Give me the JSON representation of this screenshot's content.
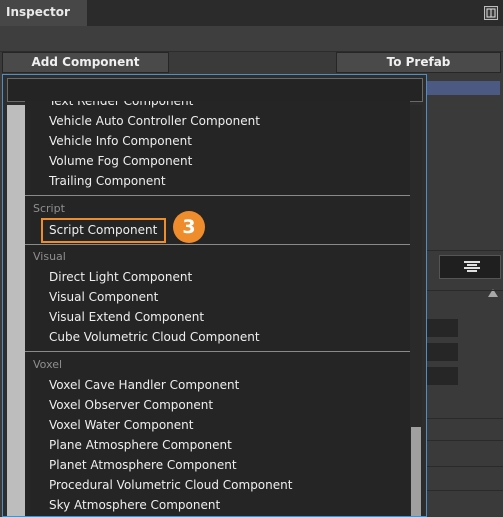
{
  "inspector": {
    "title": "Inspector",
    "add_component_label": "Add Component",
    "to_prefab_label": "To Prefab",
    "accent_color": "#ef8d2c",
    "selection_color": "#4e8fc4"
  },
  "popup": {
    "search": {
      "value": ""
    },
    "partial_item": "Text Render Component",
    "groups": [
      {
        "name": "",
        "items": [
          "Vehicle Auto Controller Component",
          "Vehicle Info Component",
          "Volume Fog Component",
          "Trailing Component"
        ]
      },
      {
        "name": "Script",
        "items": [
          "Script Component"
        ]
      },
      {
        "name": "Visual",
        "items": [
          "Direct Light Component",
          "Visual Component",
          "Visual Extend Component",
          "Cube Volumetric Cloud Component"
        ]
      },
      {
        "name": "Voxel",
        "items": [
          "Voxel Cave Handler Component",
          "Voxel Observer Component",
          "Voxel Water Component",
          "Plane Atmosphere Component",
          "Planet Atmosphere Component",
          "Procedural Volumetric Cloud Component",
          "Sky Atmosphere Component"
        ]
      }
    ],
    "highlighted_item": "Script Component",
    "step_badge": "3",
    "icons": [
      "maximize-icon",
      "align-center-icon",
      "scroll-up-arrow-icon"
    ]
  }
}
